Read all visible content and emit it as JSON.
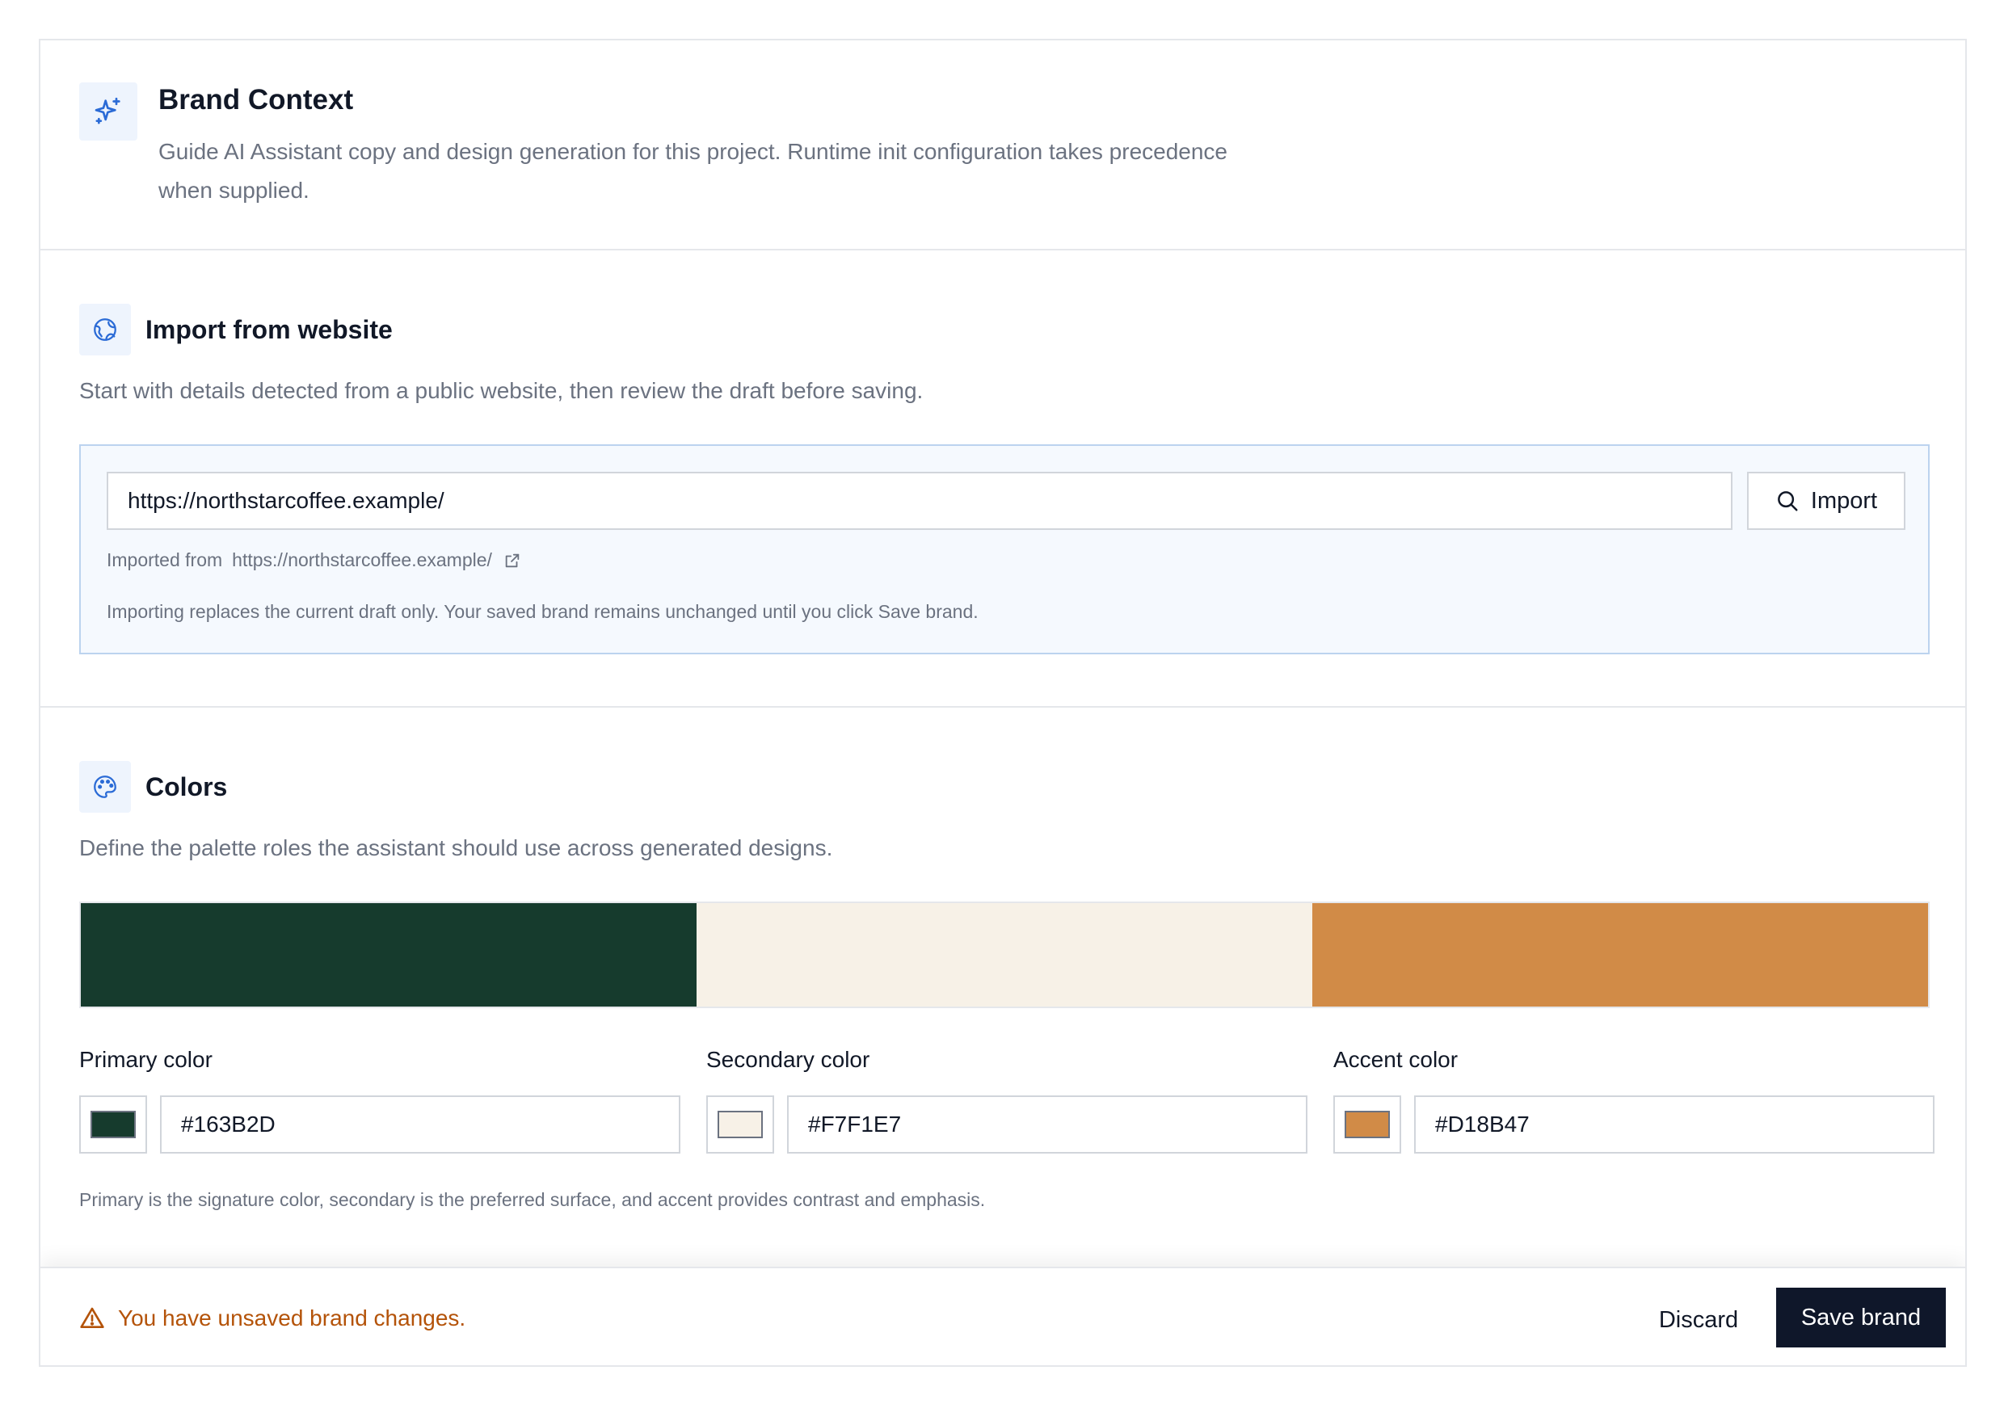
{
  "header": {
    "title": "Brand Context",
    "description_line1": "Guide AI Assistant copy and design generation for this project. Runtime init configuration takes precedence",
    "description_line2": "when supplied.",
    "icon": "sparkles-icon"
  },
  "import_section": {
    "title": "Import from website",
    "description": "Start with details detected from a public website, then review the draft before saving.",
    "icon": "globe-icon",
    "url_value": "https://northstarcoffee.example/",
    "import_button_label": "Import",
    "imported_from_label": "Imported from",
    "imported_from_url": "https://northstarcoffee.example/",
    "note": "Importing replaces the current draft only. Your saved brand remains unchanged until you click Save brand."
  },
  "colors_section": {
    "title": "Colors",
    "description": "Define the palette roles the assistant should use across generated designs.",
    "icon": "palette-icon",
    "primary": {
      "label": "Primary color",
      "value": "#163B2D",
      "swatch": "#163B2D"
    },
    "secondary": {
      "label": "Secondary color",
      "value": "#F7F1E7",
      "swatch": "#F7F1E7"
    },
    "accent": {
      "label": "Accent color",
      "value": "#D18B47",
      "swatch": "#D18B47"
    },
    "help": "Primary is the signature color, secondary is the preferred surface, and accent provides contrast and emphasis."
  },
  "footer": {
    "warning": "You have unsaved brand changes.",
    "warning_color": "#b45309",
    "discard_label": "Discard",
    "save_label": "Save brand"
  },
  "colors": {
    "accent_blue": "#2b6bd6",
    "save_bg": "#0f172a"
  }
}
